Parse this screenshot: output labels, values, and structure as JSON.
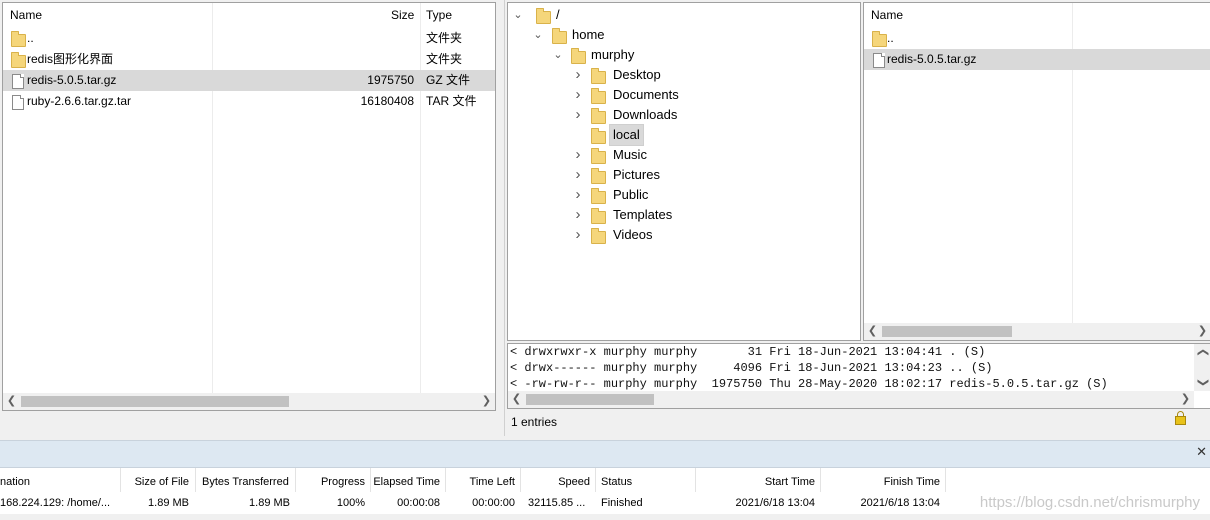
{
  "local_panel": {
    "headers": {
      "name": "Name",
      "size": "Size",
      "type": "Type"
    },
    "rows": [
      {
        "name": "..",
        "size": "",
        "type": "文件夹",
        "icon": "folder-icon",
        "selected": false
      },
      {
        "name": "redis图形化界面",
        "size": "",
        "type": "文件夹",
        "icon": "folder-icon",
        "selected": false
      },
      {
        "name": "redis-5.0.5.tar.gz",
        "size": "1975750",
        "type": "GZ 文件",
        "icon": "file-icon",
        "selected": true
      },
      {
        "name": "ruby-2.6.6.tar.gz.tar",
        "size": "16180408",
        "type": "TAR 文件",
        "icon": "file-icon",
        "selected": false
      }
    ]
  },
  "remote_tree": {
    "root": "/",
    "home": "home",
    "user": "murphy",
    "children": [
      "Desktop",
      "Documents",
      "Downloads",
      "local",
      "Music",
      "Pictures",
      "Public",
      "Templates",
      "Videos"
    ],
    "selected": "local"
  },
  "remote_list": {
    "header_name": "Name",
    "rows": [
      {
        "name": "..",
        "icon": "folder-icon",
        "selected": false
      },
      {
        "name": "redis-5.0.5.tar.gz",
        "icon": "file-icon",
        "selected": true
      }
    ]
  },
  "log": {
    "lines": [
      "< drwxrwxr-x murphy murphy       31 Fri 18-Jun-2021 13:04:41 . (S)",
      "< drwx------ murphy murphy     4096 Fri 18-Jun-2021 13:04:23 .. (S)",
      "< -rw-rw-r-- murphy murphy  1975750 Thu 28-May-2020 18:02:17 redis-5.0.5.tar.gz (S)"
    ]
  },
  "status": {
    "entries": "1 entries",
    "lock_icon": "lock-icon"
  },
  "queue": {
    "close_glyph": "✕",
    "headers": [
      "nation",
      "Size of File",
      "Bytes Transferred",
      "Progress",
      "Elapsed Time",
      "Time Left",
      "Speed",
      "Status",
      "Start Time",
      "Finish Time"
    ],
    "row": [
      "168.224.129: /home/...",
      "1.89 MB",
      "1.89 MB",
      "100%",
      "00:00:08",
      "00:00:00",
      "32115.85 ...",
      "Finished",
      "2021/6/18 13:04",
      "2021/6/18 13:04"
    ]
  },
  "watermark": "https://blog.csdn.net/chrismurphy",
  "colors": {
    "selection": "#d9d9d9",
    "folder": "#f5d67b",
    "queue_bar": "#dde8f2"
  }
}
